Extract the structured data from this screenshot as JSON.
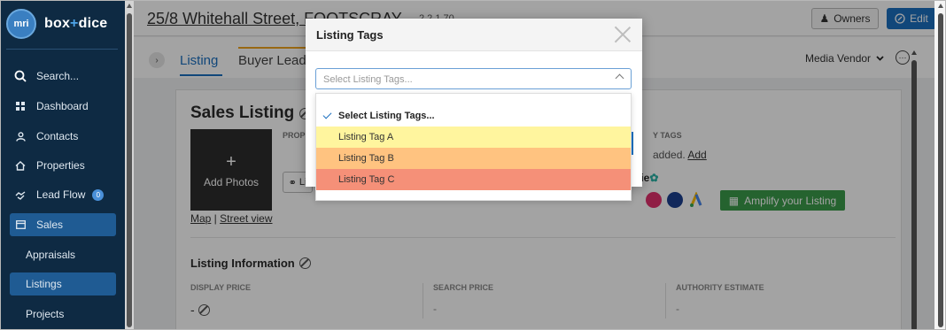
{
  "brand": {
    "logo_text": "mri",
    "name_left": "box",
    "name_plus": "+",
    "name_right": "dice"
  },
  "sidebar": {
    "search": "Search...",
    "items": [
      {
        "label": "Dashboard"
      },
      {
        "label": "Contacts"
      },
      {
        "label": "Properties"
      },
      {
        "label": "Lead Flow",
        "badge": "0"
      },
      {
        "label": "Sales"
      },
      {
        "label": "Appraisals"
      },
      {
        "label": "Listings"
      },
      {
        "label": "Projects"
      }
    ]
  },
  "header": {
    "address": "25/8 Whitehall Street, FOOTSCRAY",
    "stats": "2   2   1   70",
    "owners_label": "Owners",
    "edit_label": "Edit"
  },
  "tabs": {
    "listing": "Listing",
    "buyer_leads": "Buyer Leads",
    "vendor_select": "Media Vendor"
  },
  "listing": {
    "title": "Sales Listing",
    "add_photos": "Add Photos",
    "map": "Map",
    "separator": " | ",
    "street_view": "Street view",
    "property_label": "PROP",
    "link_btn": "Li",
    "tags_label": "Y TAGS",
    "tags_added": "added.",
    "tags_add_link": "Add",
    "beazie": "eazie",
    "amplify": "Amplify your Listing"
  },
  "info": {
    "title": "Listing Information",
    "display_price_label": "DISPLAY PRICE",
    "display_price_value": "-",
    "search_price_label": "SEARCH PRICE",
    "search_price_value": "-",
    "authority_label": "AUTHORITY ESTIMATE",
    "authority_value": "-"
  },
  "modal": {
    "title": "Listing Tags",
    "placeholder": "Select Listing Tags...",
    "options": [
      {
        "label": "Select Listing Tags...",
        "color": "#ffffff"
      },
      {
        "label": "Listing Tag A",
        "color": "#fff59e"
      },
      {
        "label": "Listing Tag B",
        "color": "#ffc380"
      },
      {
        "label": "Listing Tag C",
        "color": "#f59078"
      }
    ]
  },
  "colors": {
    "sidebar_bg": "#0e2a43",
    "accent": "#1c6fbf",
    "amplify": "#3a9b4a"
  }
}
